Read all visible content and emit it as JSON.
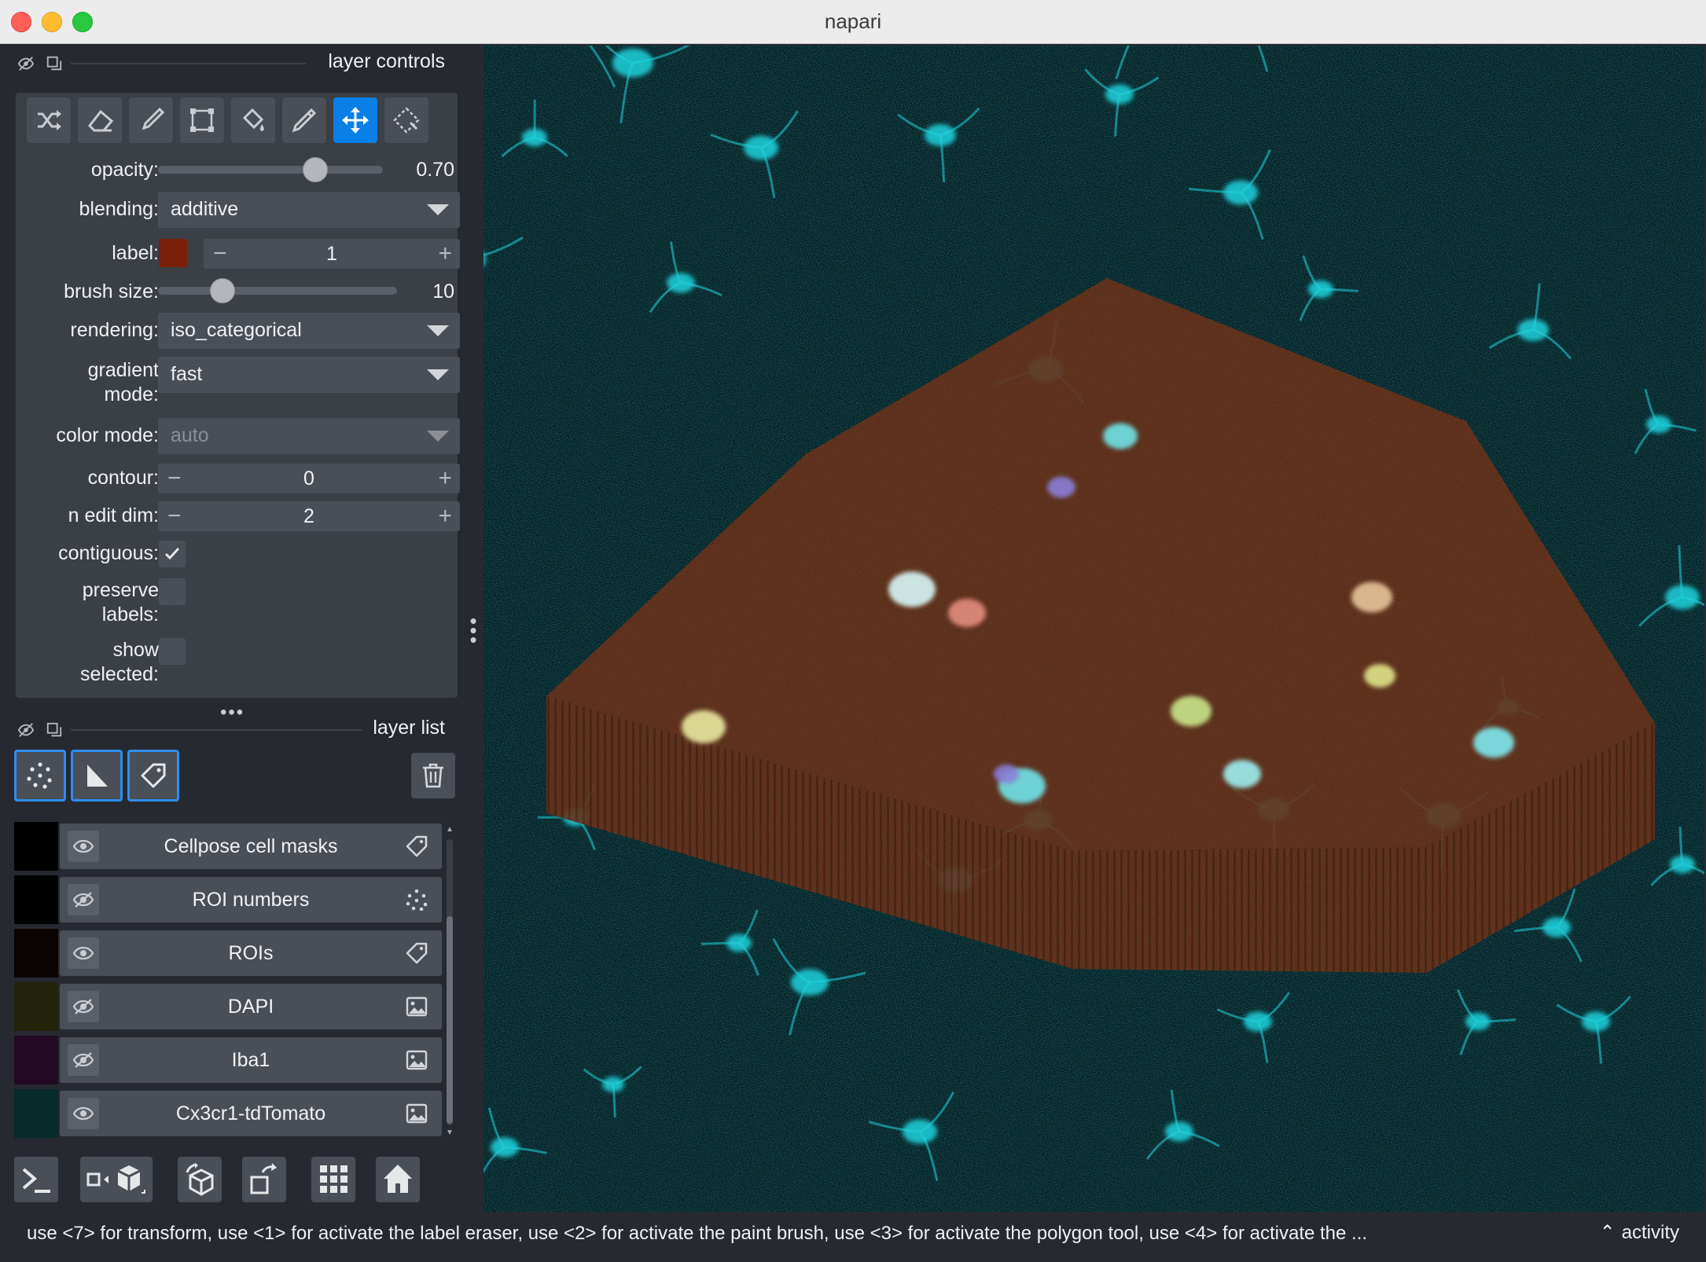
{
  "window": {
    "title": "napari"
  },
  "controls_dock": {
    "title": "layer controls"
  },
  "layer_list_dock": {
    "title": "layer list"
  },
  "tools": [
    {
      "name": "shuffle-colors-icon",
      "active": false
    },
    {
      "name": "eraser-icon",
      "active": false
    },
    {
      "name": "paint-brush-icon",
      "active": false
    },
    {
      "name": "polygon-tool-icon",
      "active": false
    },
    {
      "name": "fill-bucket-icon",
      "active": false
    },
    {
      "name": "color-picker-icon",
      "active": false
    },
    {
      "name": "pan-zoom-icon",
      "active": true
    },
    {
      "name": "transform-icon",
      "active": false
    }
  ],
  "controls": {
    "opacity": {
      "label": "opacity:",
      "value": "0.70",
      "fraction": 0.7
    },
    "blending": {
      "label": "blending:",
      "value": "additive"
    },
    "label": {
      "label": "label:",
      "value": "1",
      "color": "#7b2009"
    },
    "brush_size": {
      "label": "brush size:",
      "value": "10",
      "fraction": 0.27
    },
    "rendering": {
      "label": "rendering:",
      "value": "iso_categorical"
    },
    "gradient_mode": {
      "label_line1": "gradient",
      "label_line2": "mode:",
      "value": "fast"
    },
    "color_mode": {
      "label": "color mode:",
      "value": "auto"
    },
    "contour": {
      "label": "contour:",
      "value": "0"
    },
    "n_edit_dim": {
      "label": "n edit dim:",
      "value": "2"
    },
    "contiguous": {
      "label": "contiguous:",
      "checked": true
    },
    "preserve_labels": {
      "label_line1": "preserve",
      "label_line2": "labels:",
      "checked": false
    },
    "show_selected": {
      "label_line1": "show",
      "label_line2": "selected:",
      "checked": false
    }
  },
  "new_layer_buttons": [
    "new-points-layer-icon",
    "new-shapes-layer-icon",
    "new-labels-layer-icon"
  ],
  "layers": [
    {
      "name": "Cellpose cell masks",
      "visible": true,
      "type": "labels-icon",
      "thumb": "#020202",
      "selected": false
    },
    {
      "name": "ROI numbers",
      "visible": false,
      "type": "points-icon",
      "thumb": "#000000",
      "selected": false
    },
    {
      "name": "ROIs",
      "visible": true,
      "type": "labels-icon",
      "thumb": "#0b0302",
      "selected": false
    },
    {
      "name": "DAPI",
      "visible": false,
      "type": "image-icon",
      "thumb": "#23230a",
      "selected": false
    },
    {
      "name": "Iba1",
      "visible": false,
      "type": "image-icon",
      "thumb": "#230a23",
      "selected": false
    },
    {
      "name": "Cx3cr1-tdTomato",
      "visible": true,
      "type": "image-icon",
      "thumb": "#072a2a",
      "selected": false
    }
  ],
  "bottom_buttons": [
    "console-icon",
    "ndisplay-toggle-icon",
    "roll-axes-icon",
    "transpose-axes-icon",
    "grid-view-icon",
    "home-icon"
  ],
  "status": {
    "text": "use <7> for transform, use <1> for activate the label eraser, use <2> for activate the paint brush, use <3> for activate the polygon tool, use <4> for activate the ...",
    "activity": "activity"
  },
  "colors": {
    "accent": "#0a7fe6",
    "panel": "#3b3f46",
    "background": "#262930",
    "cyan": "#1fd6e0",
    "roi": "#7b2f12"
  }
}
